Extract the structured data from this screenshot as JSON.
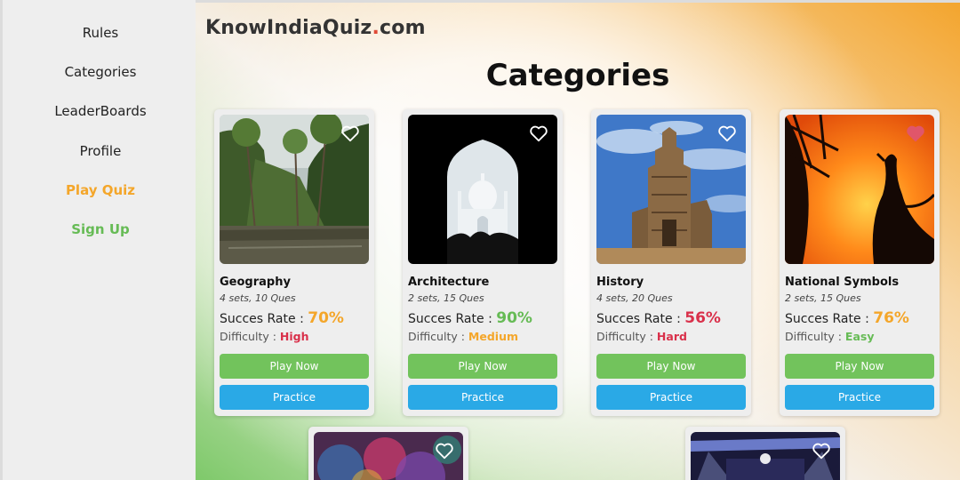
{
  "sidebar": {
    "items": [
      {
        "label": "Rules"
      },
      {
        "label": "Categories"
      },
      {
        "label": "LeaderBoards"
      },
      {
        "label": "Profile"
      },
      {
        "label": "Play Quiz",
        "color": "#f4a62a"
      },
      {
        "label": "Sign Up",
        "color": "#66bb55"
      }
    ]
  },
  "header": {
    "logo_main": "KnowIndiaQuiz",
    "logo_dot": ".",
    "logo_tld": "com",
    "title": "Categories"
  },
  "cards": [
    {
      "name": "Geography",
      "meta": "4 sets, 10 Ques",
      "rate_label": "Succes Rate :",
      "rate": "70%",
      "rate_color": "#f4a62a",
      "difficulty_label": "Difficulty :",
      "difficulty": "High",
      "difficulty_color": "#d9304a",
      "favorite": false,
      "play": "Play Now",
      "practice": "Practice"
    },
    {
      "name": "Architecture",
      "meta": "2 sets, 15 Ques",
      "rate_label": "Succes Rate :",
      "rate": "90%",
      "rate_color": "#66bb55",
      "difficulty_label": "Difficulty :",
      "difficulty": "Medium",
      "difficulty_color": "#f4a62a",
      "favorite": false,
      "play": "Play Now",
      "practice": "Practice"
    },
    {
      "name": "History",
      "meta": "4 sets, 20 Ques",
      "rate_label": "Succes Rate :",
      "rate": "56%",
      "rate_color": "#d9304a",
      "difficulty_label": "Difficulty :",
      "difficulty": "Hard",
      "difficulty_color": "#d9304a",
      "favorite": false,
      "play": "Play Now",
      "practice": "Practice"
    },
    {
      "name": "National Symbols",
      "meta": "2 sets, 15 Ques",
      "rate_label": "Succes Rate :",
      "rate": "76%",
      "rate_color": "#f4a62a",
      "difficulty_label": "Difficulty :",
      "difficulty": "Easy",
      "difficulty_color": "#66bb55",
      "favorite": true,
      "play": "Play Now",
      "practice": "Practice"
    }
  ],
  "partial_cards": [
    {
      "favorite": false
    },
    {
      "favorite": false
    }
  ],
  "icons": {
    "heart": "heart-icon"
  },
  "colors": {
    "play_button": "#72c35c",
    "practice_button": "#2aa9e6",
    "favorite_active": "#e0566a"
  }
}
